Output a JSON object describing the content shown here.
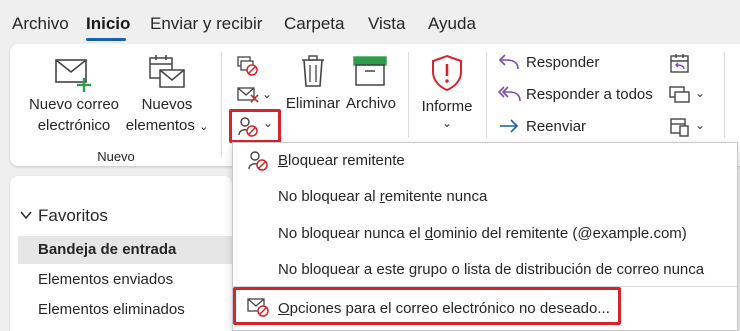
{
  "tabs": [
    "Archivo",
    "Inicio",
    "Enviar y recibir",
    "Carpeta",
    "Vista",
    "Ayuda"
  ],
  "ribbon": {
    "new_email_line1": "Nuevo correo",
    "new_email_line2": "electrónico",
    "new_items_line1": "Nuevos",
    "new_items_line2": "elementos",
    "group_new": "Nuevo",
    "delete": "Eliminar",
    "archive": "Archivo",
    "report": "Informe",
    "reply": "Responder",
    "reply_all": "Responder a todos",
    "forward": "Reenviar"
  },
  "favorites": {
    "title": "Favoritos",
    "items": [
      "Bandeja de entrada",
      "Elementos enviados",
      "Elementos eliminados"
    ]
  },
  "dropdown": {
    "block_sender": {
      "key": "B",
      "rest": "loquear remitente"
    },
    "never_block_sender": {
      "pre": "No bloquear al ",
      "key": "r",
      "post": "emitente nunca"
    },
    "never_block_domain": {
      "pre": "No bloquear nunca el ",
      "key": "d",
      "post": "ominio del remitente (@example.com)"
    },
    "never_block_group": "No bloquear a este grupo o lista de distribución de correo nunca",
    "junk_options": {
      "key": "O",
      "rest": "pciones para el correo electrónico no deseado..."
    }
  },
  "colors": {
    "accent": "#1a5fb4",
    "highlight": "#d4252c",
    "green": "#2e9e4a",
    "purple": "#7a4fb0"
  },
  "icons": [
    "new-mail-icon",
    "new-items-icon",
    "ignore-icon",
    "cleanup-icon",
    "junk-icon",
    "delete-icon",
    "archive-icon",
    "report-shield-icon",
    "reply-icon",
    "reply-all-icon",
    "forward-icon",
    "meeting-icon",
    "more-respond-icon",
    "team-icon",
    "block-sender-icon",
    "junk-options-icon"
  ]
}
